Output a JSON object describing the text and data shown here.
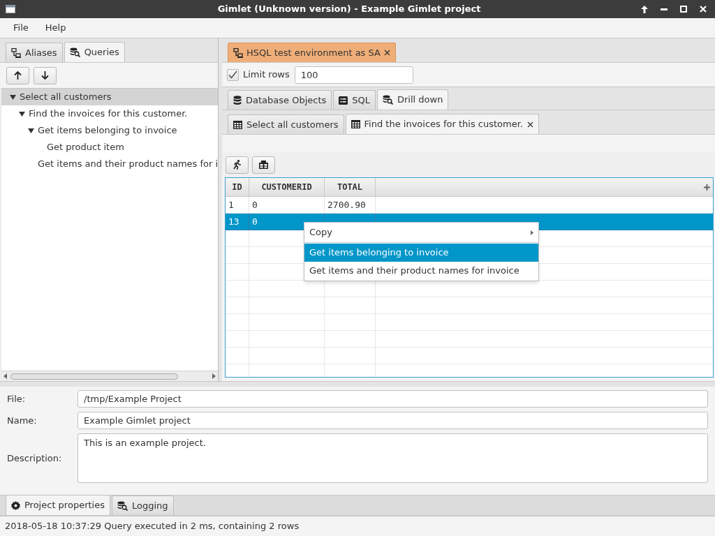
{
  "window": {
    "title": "Gimlet (Unknown version) - Example Gimlet project"
  },
  "menu": [
    "File",
    "Help"
  ],
  "left_tabs": [
    {
      "label": "Aliases",
      "selected": false
    },
    {
      "label": "Queries",
      "selected": true
    }
  ],
  "tree": [
    {
      "label": "Select all customers",
      "selected": true,
      "expanded": true,
      "children": [
        {
          "label": "Find the invoices for this customer.",
          "selected": false,
          "expanded": true,
          "children": [
            {
              "label": "Get items belonging to invoice",
              "selected": false,
              "expanded": true,
              "children": [
                {
                  "label": "Get product item",
                  "selected": false
                }
              ]
            },
            {
              "label": "Get items and their product names for i",
              "selected": false
            }
          ]
        }
      ]
    }
  ],
  "connection_tab": {
    "label": "HSQL test environment as SA"
  },
  "limit_rows": {
    "label": "Limit rows",
    "checked": true,
    "value": "100"
  },
  "view_tabs": [
    {
      "label": "Database Objects",
      "selected": false
    },
    {
      "label": "SQL",
      "selected": false
    },
    {
      "label": "Drill down",
      "selected": true
    }
  ],
  "result_tabs": [
    {
      "label": "Select all customers",
      "selected": false,
      "closable": false
    },
    {
      "label": "Find the invoices for this customer.",
      "selected": true,
      "closable": true
    }
  ],
  "table": {
    "columns": [
      "ID",
      "CUSTOMERID",
      "TOTAL"
    ],
    "rows": [
      {
        "cells": [
          "1",
          "0",
          "2700.90"
        ],
        "selected": false
      },
      {
        "cells": [
          "13",
          "0"
        ],
        "selected": true
      }
    ]
  },
  "context_menu": {
    "items": [
      {
        "label": "Copy",
        "kind": "submenu",
        "selected": false
      },
      {
        "label": "Get items belonging to invoice",
        "kind": "item",
        "selected": true
      },
      {
        "label": "Get items and their product names for invoice",
        "kind": "item",
        "selected": false
      }
    ]
  },
  "properties": [
    {
      "label": "File:",
      "value": "/tmp/Example Project",
      "kind": "line"
    },
    {
      "label": "Name:",
      "value": "Example Gimlet project",
      "kind": "line"
    },
    {
      "label": "Description:",
      "value": "This is an example project.",
      "kind": "area"
    }
  ],
  "bottom_tabs": [
    {
      "label": "Project properties",
      "selected": true
    },
    {
      "label": "Logging",
      "selected": false
    }
  ],
  "status_bar": "2018-05-18 10:37:29 Query executed in 2 ms, containing 2 rows"
}
